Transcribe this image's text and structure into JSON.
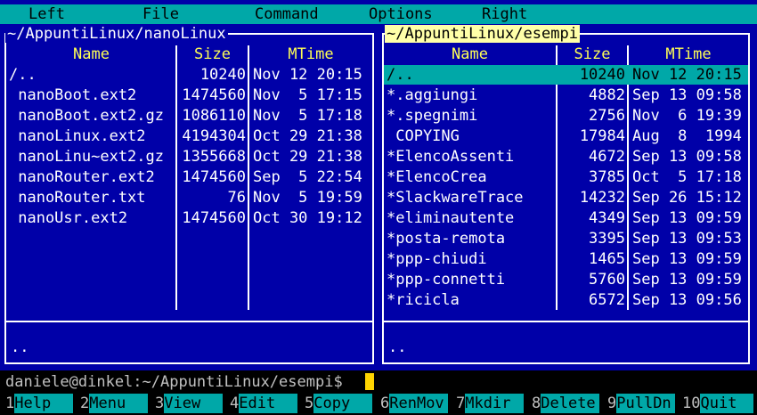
{
  "menu": {
    "items": [
      "Left",
      "File",
      "Command",
      "Options",
      "Right"
    ]
  },
  "left_panel": {
    "path": "~/AppuntiLinux/nanoLinux",
    "headers": {
      "name": "Name",
      "size": "Size",
      "mtime": "MTime"
    },
    "rows": [
      {
        "name": "/..",
        "size": "10240",
        "mtime": "Nov 12 20:15"
      },
      {
        "name": " nanoBoot.ext2",
        "size": "1474560",
        "mtime": "Nov  5 17:15"
      },
      {
        "name": " nanoBoot.ext2.gz",
        "size": "1086110",
        "mtime": "Nov  5 17:18"
      },
      {
        "name": " nanoLinux.ext2",
        "size": "4194304",
        "mtime": "Oct 29 21:38"
      },
      {
        "name": " nanoLinu~ext2.gz",
        "size": "1355668",
        "mtime": "Oct 29 21:38"
      },
      {
        "name": " nanoRouter.ext2",
        "size": "1474560",
        "mtime": "Sep  5 22:54"
      },
      {
        "name": " nanoRouter.txt",
        "size": "76",
        "mtime": "Nov  5 19:59"
      },
      {
        "name": " nanoUsr.ext2",
        "size": "1474560",
        "mtime": "Oct 30 19:12"
      }
    ],
    "mini_status": ".."
  },
  "right_panel": {
    "path": "~/AppuntiLinux/esempi",
    "headers": {
      "name": "Name",
      "size": "Size",
      "mtime": "MTime"
    },
    "rows": [
      {
        "name": "/..",
        "size": "10240",
        "mtime": "Nov 12 20:15"
      },
      {
        "name": "*.aggiungi",
        "size": "4882",
        "mtime": "Sep 13 09:58"
      },
      {
        "name": "*.spegnimi",
        "size": "2756",
        "mtime": "Nov  6 19:39"
      },
      {
        "name": " COPYING",
        "size": "17984",
        "mtime": "Aug  8  1994"
      },
      {
        "name": "*ElencoAssenti",
        "size": "4672",
        "mtime": "Sep 13 09:58"
      },
      {
        "name": "*ElencoCrea",
        "size": "3785",
        "mtime": "Oct  5 17:18"
      },
      {
        "name": "*SlackwareTrace",
        "size": "14232",
        "mtime": "Sep 26 15:12"
      },
      {
        "name": "*eliminautente",
        "size": "4349",
        "mtime": "Sep 13 09:59"
      },
      {
        "name": "*posta-remota",
        "size": "3395",
        "mtime": "Sep 13 09:53"
      },
      {
        "name": "*ppp-chiudi",
        "size": "1465",
        "mtime": "Sep 13 09:59"
      },
      {
        "name": "*ppp-connetti",
        "size": "5760",
        "mtime": "Sep 13 09:59"
      },
      {
        "name": "*ricicla",
        "size": "6572",
        "mtime": "Sep 13 09:56"
      }
    ],
    "mini_status": ".."
  },
  "command_line": {
    "prompt": "daniele@dinkel:~/AppuntiLinux/esempi$"
  },
  "function_keys": [
    {
      "num": "1",
      "label": "Help"
    },
    {
      "num": "2",
      "label": "Menu"
    },
    {
      "num": "3",
      "label": "View"
    },
    {
      "num": "4",
      "label": "Edit"
    },
    {
      "num": "5",
      "label": "Copy"
    },
    {
      "num": "6",
      "label": "RenMov"
    },
    {
      "num": "7",
      "label": "Mkdir"
    },
    {
      "num": "8",
      "label": "Delete"
    },
    {
      "num": "9",
      "label": "PullDn"
    },
    {
      "num": "10",
      "label": "Quit"
    }
  ],
  "colors": {
    "background": "#0000a8",
    "menu_bar": "#00a8a8",
    "header_text": "#ffff54",
    "active_title_bg": "#ffffa8",
    "cursor_bar": "#00a8a8"
  }
}
